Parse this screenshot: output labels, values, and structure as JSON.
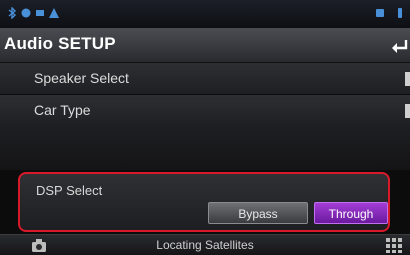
{
  "status_bar": {
    "icons": [
      "bluetooth-icon",
      "phone-icon",
      "signal-icon",
      "warning-icon",
      "battery-icon",
      "phone-small-icon"
    ]
  },
  "header": {
    "title": "Audio SETUP",
    "back_icon": "return-icon"
  },
  "menu": {
    "items": [
      {
        "label": "Speaker Select"
      },
      {
        "label": "Car Type"
      }
    ]
  },
  "dsp": {
    "label": "DSP Select",
    "options": [
      "Bypass",
      "Through"
    ],
    "selected": "Through"
  },
  "footer": {
    "status": "Locating Satellites",
    "left_icon": "camera-icon",
    "right_icon": "grid-menu-icon"
  },
  "colors": {
    "highlight_border": "#d8192a",
    "selected_button": "#8a2bc2",
    "status_icon_blue": "#4a90d9"
  }
}
